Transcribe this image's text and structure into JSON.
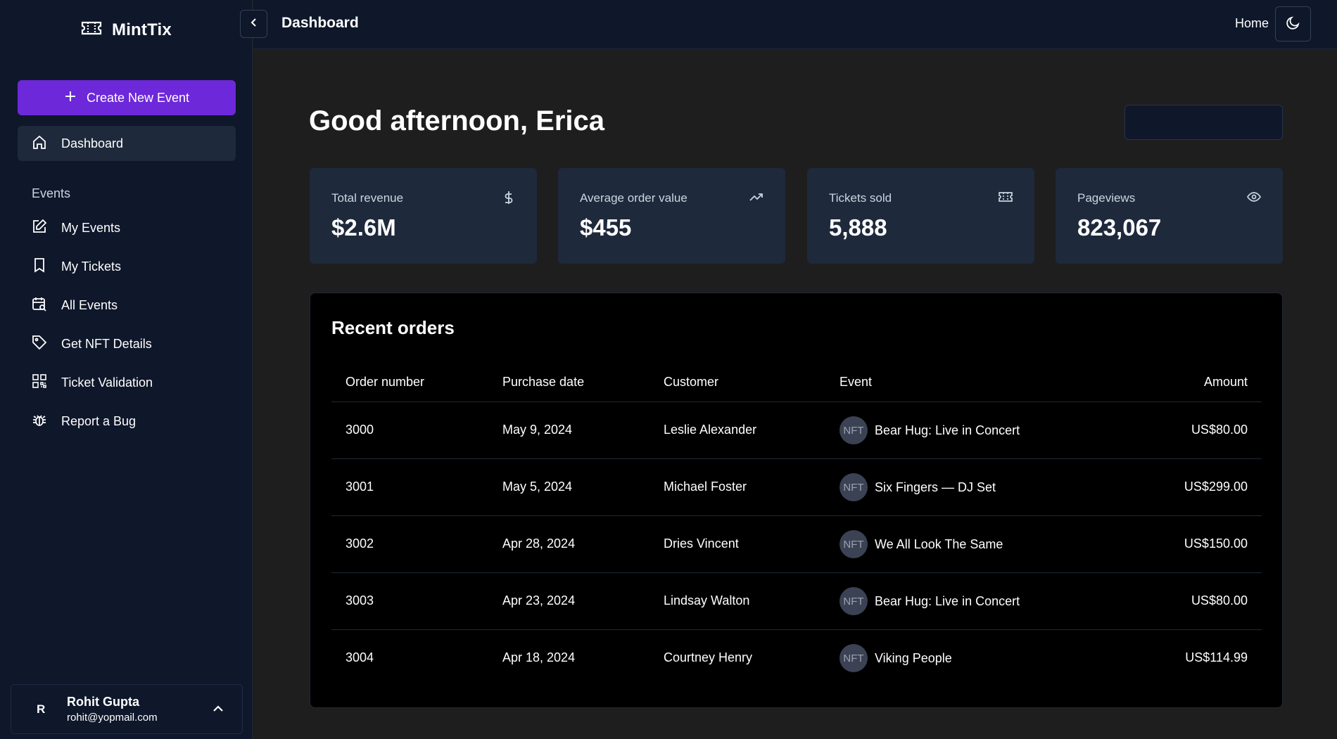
{
  "brand": {
    "name": "MintTix",
    "icon": "ticket-icon"
  },
  "sidebar": {
    "create_button": "Create New Event",
    "dashboard": "Dashboard",
    "section_label": "Events",
    "items": [
      {
        "label": "My Events",
        "icon": "edit-icon"
      },
      {
        "label": "My Tickets",
        "icon": "bookmark-icon"
      },
      {
        "label": "All Events",
        "icon": "calendar-search-icon"
      },
      {
        "label": "Get NFT Details",
        "icon": "tag-icon"
      },
      {
        "label": "Ticket Validation",
        "icon": "qr-code-icon"
      },
      {
        "label": "Report a Bug",
        "icon": "bug-icon"
      }
    ],
    "user": {
      "initial": "R",
      "name": "Rohit Gupta",
      "email": "rohit@yopmail.com"
    }
  },
  "topbar": {
    "title": "Dashboard",
    "home": "Home"
  },
  "main": {
    "greeting": "Good afternoon, Erica",
    "stats": [
      {
        "label": "Total revenue",
        "value": "$2.6M",
        "icon": "dollar-icon"
      },
      {
        "label": "Average order value",
        "value": "$455",
        "icon": "trending-up-icon"
      },
      {
        "label": "Tickets sold",
        "value": "5,888",
        "icon": "ticket-icon"
      },
      {
        "label": "Pageviews",
        "value": "823,067",
        "icon": "eye-icon"
      }
    ],
    "orders": {
      "title": "Recent orders",
      "columns": [
        "Order number",
        "Purchase date",
        "Customer",
        "Event",
        "Amount"
      ],
      "badge": "NFT",
      "rows": [
        {
          "order": "3000",
          "date": "May 9, 2024",
          "customer": "Leslie Alexander",
          "event": "Bear Hug: Live in Concert",
          "amount": "US$80.00"
        },
        {
          "order": "3001",
          "date": "May 5, 2024",
          "customer": "Michael Foster",
          "event": "Six Fingers — DJ Set",
          "amount": "US$299.00"
        },
        {
          "order": "3002",
          "date": "Apr 28, 2024",
          "customer": "Dries Vincent",
          "event": "We All Look The Same",
          "amount": "US$150.00"
        },
        {
          "order": "3003",
          "date": "Apr 23, 2024",
          "customer": "Lindsay Walton",
          "event": "Bear Hug: Live in Concert",
          "amount": "US$80.00"
        },
        {
          "order": "3004",
          "date": "Apr 18, 2024",
          "customer": "Courtney Henry",
          "event": "Viking People",
          "amount": "US$114.99"
        }
      ]
    }
  },
  "colors": {
    "accent": "#6d28d9",
    "sidebar_bg": "#0f172a",
    "card_bg": "#1e293b",
    "page_bg": "#1e1e1e"
  }
}
